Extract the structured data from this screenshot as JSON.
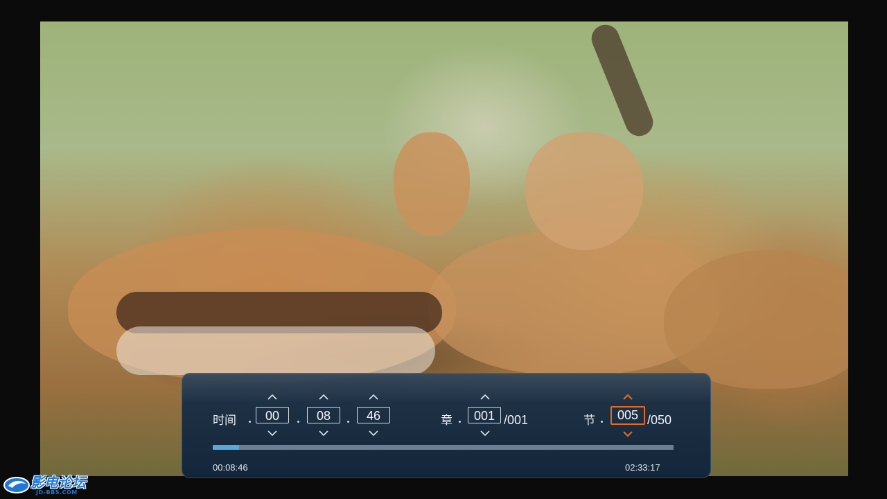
{
  "osd": {
    "time": {
      "label": "时间",
      "hours": "00",
      "minutes": "08",
      "seconds": "46"
    },
    "chapter": {
      "label": "章",
      "current": "001",
      "total": "/001"
    },
    "section": {
      "label": "节",
      "current": "005",
      "total": "/050"
    },
    "progress": {
      "fraction": 0.057,
      "elapsed": "00:08:46",
      "duration": "02:33:17"
    }
  },
  "watermark": {
    "logo_text": "影电论坛",
    "logo_sub": "JD-BBS.COM"
  },
  "colors": {
    "focus_accent": "#e46a1e",
    "progress_fill": "#5aa6de",
    "osd_background": "#16304a"
  },
  "icons": {
    "up": "chevron-up-icon",
    "down": "chevron-down-icon"
  }
}
